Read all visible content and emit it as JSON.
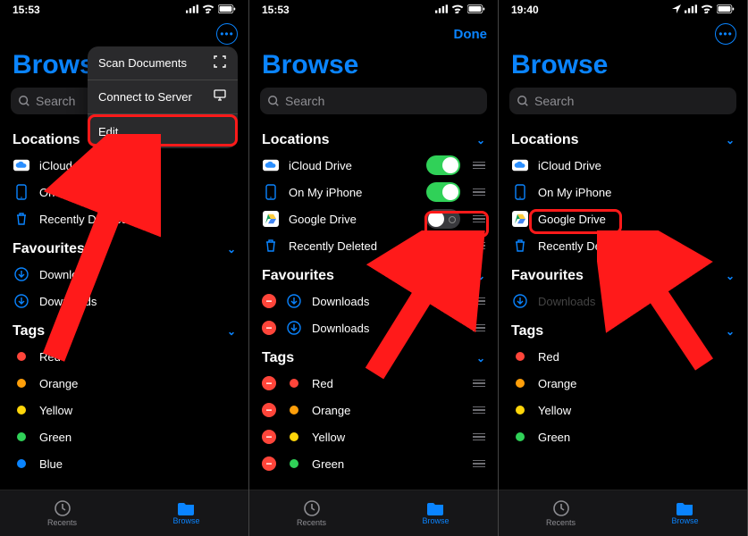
{
  "colors": {
    "accent": "#0a84ff",
    "highlight": "#ff1a1a"
  },
  "tagColors": {
    "Red": "#ff453a",
    "Orange": "#ff9f0a",
    "Yellow": "#ffd60a",
    "Green": "#30d158",
    "Blue": "#0a84ff"
  },
  "panes": [
    {
      "statusTime": "15:53",
      "statusHasLocation": false,
      "navButton": "more",
      "title": "Browse",
      "searchPlaceholder": "Search",
      "contextMenu": [
        {
          "label": "Scan Documents",
          "icon": "scan"
        },
        {
          "label": "Connect to Server",
          "icon": "server"
        },
        {
          "label": "Edit",
          "icon": "",
          "highlight": true
        }
      ],
      "sections": [
        {
          "title": "Locations",
          "items": [
            {
              "icon": "icloud",
              "label": "iCloud Drive"
            },
            {
              "icon": "iphone",
              "label": "On My iPhone"
            },
            {
              "icon": "trash",
              "label": "Recently Deleted",
              "truncLabel": "Recently Del…"
            }
          ]
        },
        {
          "title": "Favourites",
          "items": [
            {
              "icon": "download",
              "label": "Downloads"
            },
            {
              "icon": "download",
              "label": "Downloads"
            }
          ]
        },
        {
          "title": "Tags",
          "items": [
            {
              "swatch": "Red",
              "label": "Red"
            },
            {
              "swatch": "Orange",
              "label": "Orange"
            },
            {
              "swatch": "Yellow",
              "label": "Yellow"
            },
            {
              "swatch": "Green",
              "label": "Green"
            },
            {
              "swatch": "Blue",
              "label": "Blue"
            }
          ]
        }
      ],
      "tabs": {
        "recents": "Recents",
        "browse": "Browse"
      }
    },
    {
      "statusTime": "15:53",
      "statusHasLocation": false,
      "navButton": "done",
      "doneLabel": "Done",
      "title": "Browse",
      "searchPlaceholder": "Search",
      "sections": [
        {
          "title": "Locations",
          "items": [
            {
              "icon": "icloud",
              "label": "iCloud Drive",
              "toggle": "on",
              "handle": true
            },
            {
              "icon": "iphone",
              "label": "On My iPhone",
              "toggle": "on",
              "handle": true
            },
            {
              "icon": "gdrive",
              "label": "Google Drive",
              "toggle": "off",
              "handle": true,
              "toggleHighlight": true
            },
            {
              "icon": "trash",
              "label": "Recently Deleted",
              "handle": true
            }
          ]
        },
        {
          "title": "Favourites",
          "items": [
            {
              "remove": true,
              "icon": "download",
              "label": "Downloads",
              "handle": true
            },
            {
              "remove": true,
              "icon": "download",
              "label": "Downloads",
              "handle": true
            }
          ]
        },
        {
          "title": "Tags",
          "items": [
            {
              "remove": true,
              "swatch": "Red",
              "label": "Red",
              "handle": true
            },
            {
              "remove": true,
              "swatch": "Orange",
              "label": "Orange",
              "handle": true
            },
            {
              "remove": true,
              "swatch": "Yellow",
              "label": "Yellow",
              "handle": true
            },
            {
              "remove": true,
              "swatch": "Green",
              "label": "Green",
              "handle": true
            }
          ]
        }
      ],
      "tabs": {
        "recents": "Recents",
        "browse": "Browse"
      }
    },
    {
      "statusTime": "19:40",
      "statusHasLocation": true,
      "navButton": "more",
      "title": "Browse",
      "searchPlaceholder": "Search",
      "sections": [
        {
          "title": "Locations",
          "items": [
            {
              "icon": "icloud",
              "label": "iCloud Drive"
            },
            {
              "icon": "iphone",
              "label": "On My iPhone"
            },
            {
              "icon": "gdrive",
              "label": "Google Drive",
              "rowHighlight": true
            },
            {
              "icon": "trash",
              "label": "Recently Deleted",
              "truncLabel": "Recently Del…"
            }
          ]
        },
        {
          "title": "Favourites",
          "items": [
            {
              "icon": "download",
              "label": "Downloads",
              "dim": true
            }
          ]
        },
        {
          "title": "Tags",
          "items": [
            {
              "swatch": "Red",
              "label": "Red"
            },
            {
              "swatch": "Orange",
              "label": "Orange"
            },
            {
              "swatch": "Yellow",
              "label": "Yellow"
            },
            {
              "swatch": "Green",
              "label": "Green"
            }
          ]
        }
      ],
      "tabs": {
        "recents": "Recents",
        "browse": "Browse"
      }
    }
  ]
}
